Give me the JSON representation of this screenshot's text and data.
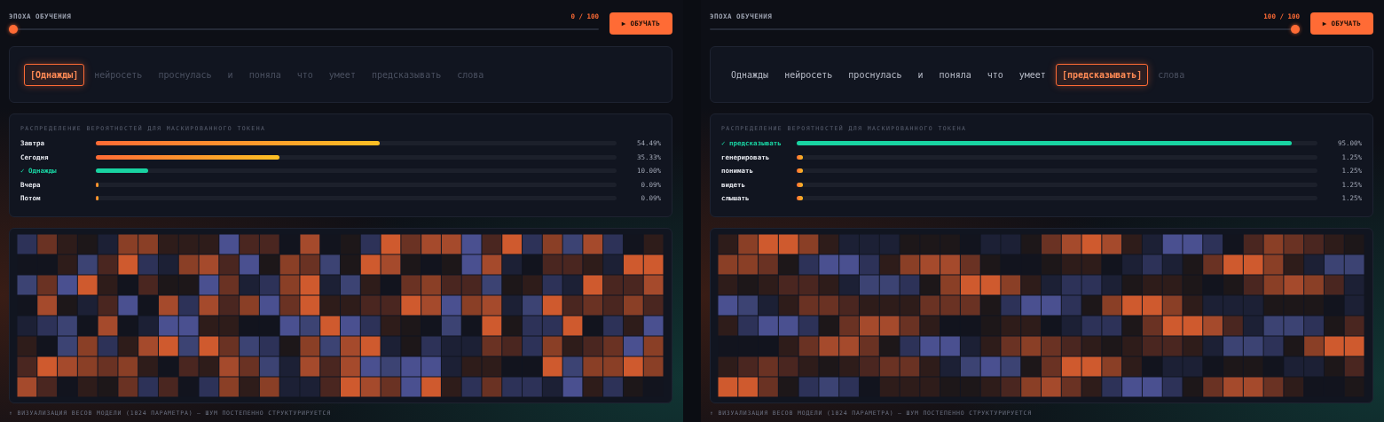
{
  "panels": [
    {
      "epoch": {
        "label": "ЭПОХА ОБУЧЕНИЯ",
        "reading": "0 / 100",
        "level": 0
      },
      "train_button": "▶ ОБУЧАТЬ",
      "tokens": [
        {
          "text": "[Однажды]",
          "selected": true,
          "dimmed": false
        },
        {
          "text": "нейросеть",
          "selected": false,
          "dimmed": true
        },
        {
          "text": "проснулась",
          "selected": false,
          "dimmed": true
        },
        {
          "text": "и",
          "selected": false,
          "dimmed": true
        },
        {
          "text": "поняла",
          "selected": false,
          "dimmed": true
        },
        {
          "text": "что",
          "selected": false,
          "dimmed": true
        },
        {
          "text": "умеет",
          "selected": false,
          "dimmed": true
        },
        {
          "text": "предсказывать",
          "selected": false,
          "dimmed": true
        },
        {
          "text": "слова",
          "selected": false,
          "dimmed": true
        }
      ],
      "distribution": {
        "title": "РАСПРЕДЕЛЕНИЕ ВЕРОЯТНОСТЕЙ ДЛЯ МАСКИРОВАННОГО ТОКЕНА",
        "rows": [
          {
            "label": "Завтра",
            "level": 0.5449,
            "reading": "54.49%",
            "correct": false
          },
          {
            "label": "Сегодня",
            "level": 0.3533,
            "reading": "35.33%",
            "correct": false
          },
          {
            "label": "✓ Однажды",
            "level": 0.1,
            "reading": "10.00%",
            "correct": true
          },
          {
            "label": "Вчера",
            "level": 0.0009,
            "reading": "0.09%",
            "correct": false
          },
          {
            "label": "Потом",
            "level": 0.0009,
            "reading": "0.09%",
            "correct": false
          }
        ]
      },
      "caption": "↑ ВИЗУАЛИЗАЦИЯ ВЕСОВ МОДЕЛИ (1024 ПАРАМЕТРА) — ШУМ ПОСТЕПЕННО СТРУКТУРИРУЕТСЯ"
    },
    {
      "epoch": {
        "label": "ЭПОХА ОБУЧЕНИЯ",
        "reading": "100 / 100",
        "level": 1
      },
      "train_button": "▶ ОБУЧАТЬ",
      "tokens": [
        {
          "text": "Однажды",
          "selected": false,
          "dimmed": false
        },
        {
          "text": "нейросеть",
          "selected": false,
          "dimmed": false
        },
        {
          "text": "проснулась",
          "selected": false,
          "dimmed": false
        },
        {
          "text": "и",
          "selected": false,
          "dimmed": false
        },
        {
          "text": "поняла",
          "selected": false,
          "dimmed": false
        },
        {
          "text": "что",
          "selected": false,
          "dimmed": false
        },
        {
          "text": "умеет",
          "selected": false,
          "dimmed": false
        },
        {
          "text": "[предсказывать]",
          "selected": true,
          "dimmed": false
        },
        {
          "text": "слова",
          "selected": false,
          "dimmed": true
        }
      ],
      "distribution": {
        "title": "РАСПРЕДЕЛЕНИЕ ВЕРОЯТНОСТЕЙ ДЛЯ МАСКИРОВАННОГО ТОКЕНА",
        "rows": [
          {
            "label": "✓ предсказывать",
            "level": 0.95,
            "reading": "95.00%",
            "correct": true
          },
          {
            "label": "генерировать",
            "level": 0.0125,
            "reading": "1.25%",
            "correct": false
          },
          {
            "label": "понимать",
            "level": 0.0125,
            "reading": "1.25%",
            "correct": false
          },
          {
            "label": "видеть",
            "level": 0.0125,
            "reading": "1.25%",
            "correct": false
          },
          {
            "label": "слышать",
            "level": 0.0125,
            "reading": "1.25%",
            "correct": false
          }
        ]
      },
      "caption": "↑ ВИЗУАЛИЗАЦИЯ ВЕСОВ МОДЕЛИ (1024 ПАРАМЕТРА) — ШУМ ПОСТЕПЕННО СТРУКТУРИРУЕТСЯ"
    }
  ]
}
